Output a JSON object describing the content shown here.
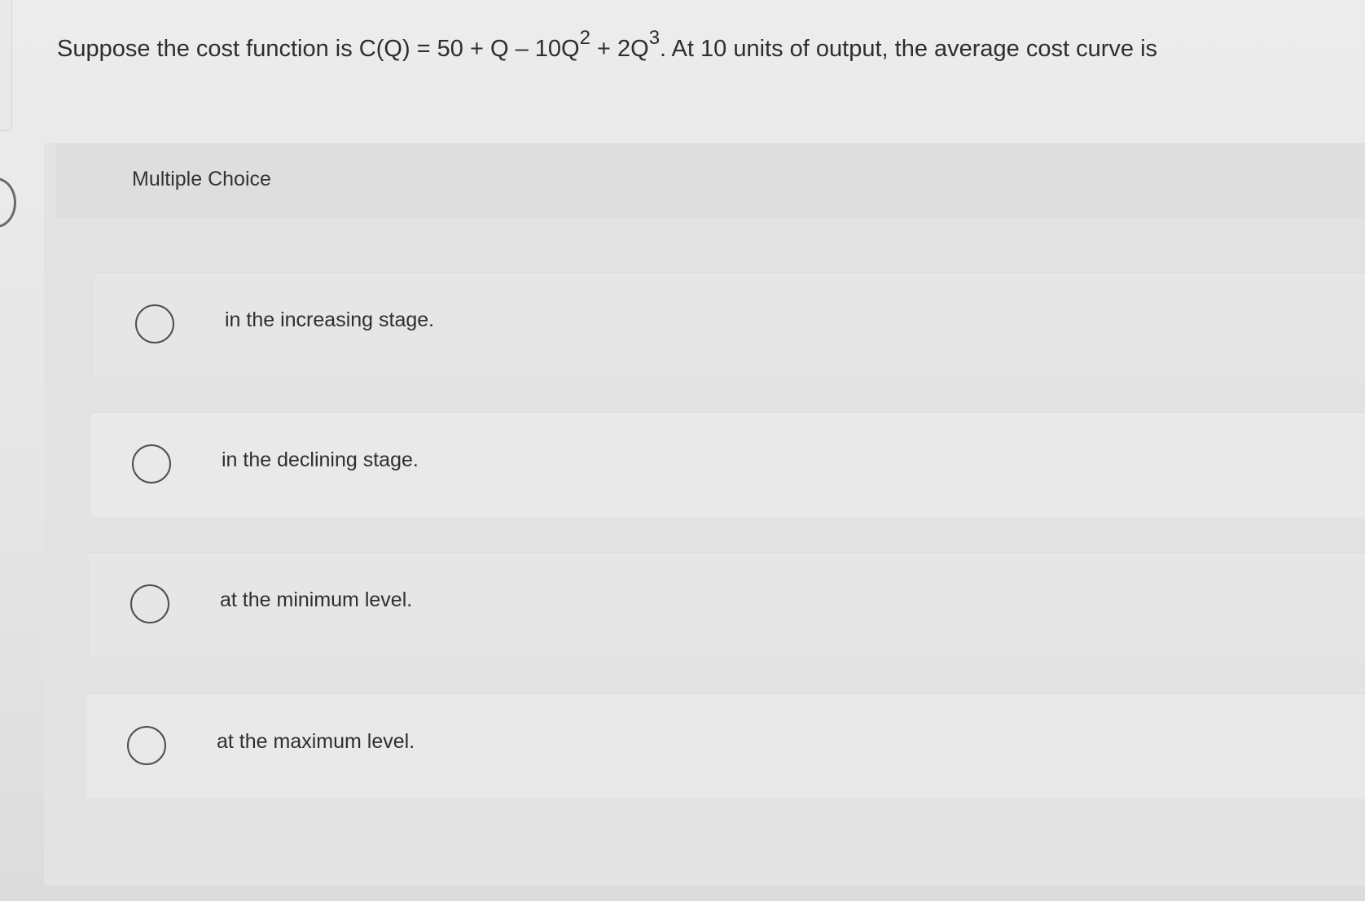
{
  "question": {
    "prefix": "Suppose the cost function is C(Q) = 50 + Q – 10Q",
    "exp1": "2",
    "middle": " + 2Q",
    "exp2": "3",
    "suffix": ". At 10 units of output, the average cost curve is"
  },
  "section": {
    "label": "Multiple Choice"
  },
  "options": [
    {
      "label": "in the increasing stage."
    },
    {
      "label": "in the declining stage."
    },
    {
      "label": "at the minimum level."
    },
    {
      "label": "at the maximum level."
    }
  ]
}
